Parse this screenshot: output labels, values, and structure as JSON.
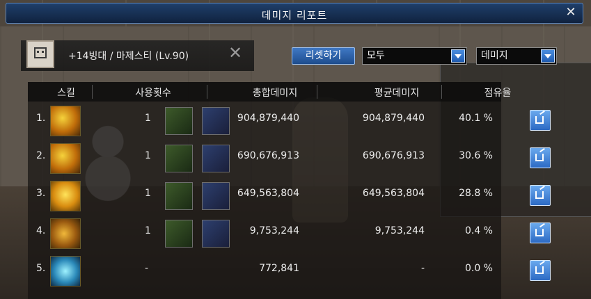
{
  "window": {
    "title": "데미지 리포트",
    "close_glyph": "✕"
  },
  "character": {
    "name": "+14빙대 / 마제스티 (Lv.90)",
    "close_glyph": "✕"
  },
  "controls": {
    "reset_label": "리셋하기",
    "scope_value": "모두",
    "type_value": "데미지"
  },
  "table": {
    "headers": {
      "skill": "스킬",
      "uses": "사용횟수",
      "total": "총합데미지",
      "average": "평균데미지",
      "share": "점유율"
    },
    "rows": [
      {
        "rank": "1.",
        "uses": "1",
        "total": "904,879,440",
        "average": "904,879,440",
        "share": "40.1 %"
      },
      {
        "rank": "2.",
        "uses": "1",
        "total": "690,676,913",
        "average": "690,676,913",
        "share": "30.6 %"
      },
      {
        "rank": "3.",
        "uses": "1",
        "total": "649,563,804",
        "average": "649,563,804",
        "share": "28.8 %"
      },
      {
        "rank": "4.",
        "uses": "1",
        "total": "9,753,244",
        "average": "9,753,244",
        "share": "0.4 %"
      },
      {
        "rank": "5.",
        "uses": "-",
        "total": "772,841",
        "average": "-",
        "share": "0.0 %"
      }
    ]
  },
  "icons": {
    "share": "share-icon",
    "dropdown": "chevron-down-icon",
    "close": "close-icon"
  },
  "colors": {
    "title_bar": "#1f3f6a",
    "button_blue": "#2c6ac4",
    "text": "#ececec"
  }
}
